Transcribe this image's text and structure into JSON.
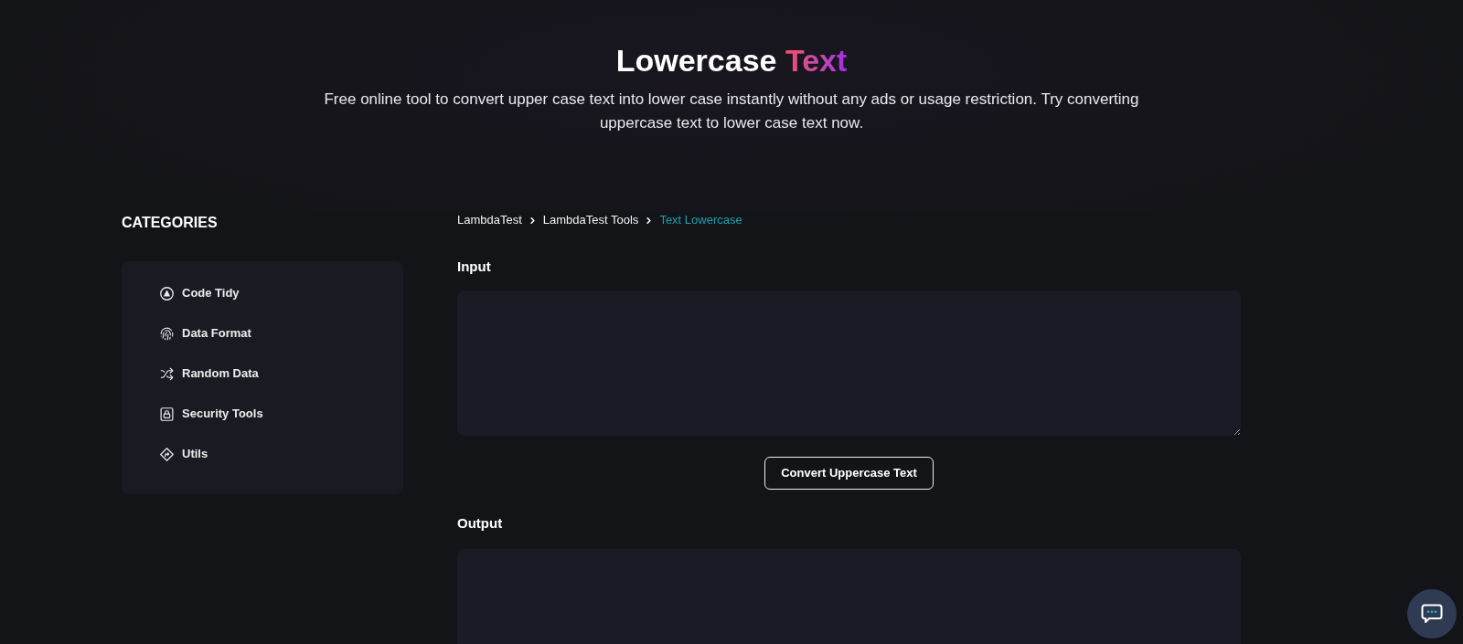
{
  "header": {
    "title": "Lowercase",
    "title_highlight": "Text",
    "description": "Free online tool to convert upper case text into lower case instantly without any ads or usage restriction. Try converting uppercase text to lower case text now."
  },
  "sidebar": {
    "heading": "CATEGORIES",
    "items": [
      {
        "label": "Code Tidy"
      },
      {
        "label": "Data Format"
      },
      {
        "label": "Random Data"
      },
      {
        "label": "Security Tools"
      },
      {
        "label": "Utils"
      }
    ]
  },
  "breadcrumb": [
    {
      "label": "LambdaTest",
      "current": false
    },
    {
      "label": "LambdaTest Tools",
      "current": false
    },
    {
      "label": "Text Lowercase",
      "current": true
    }
  ],
  "input": {
    "label": "Input"
  },
  "convert_button": {
    "label": "Convert Uppercase Text"
  },
  "output": {
    "label": "Output"
  }
}
